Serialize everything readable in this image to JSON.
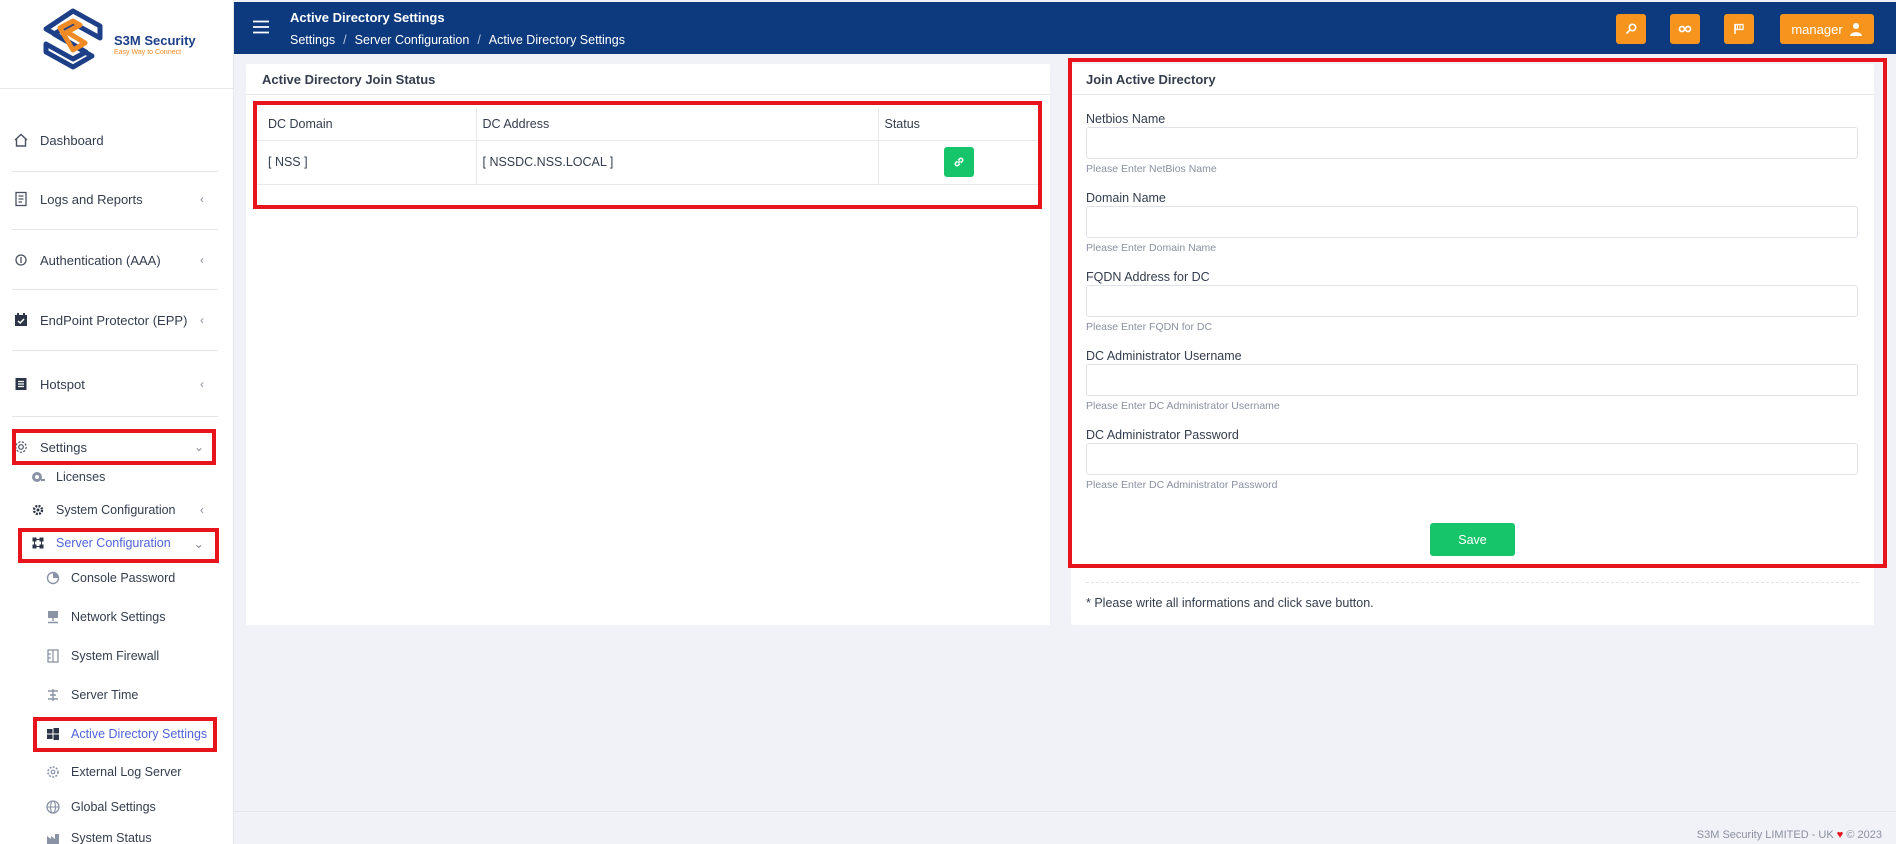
{
  "app": {
    "brand": "S3M Security",
    "tagline": "Easy Way to Connect"
  },
  "header": {
    "title": "Active Directory Settings",
    "breadcrumb": [
      "Settings",
      "Server Configuration",
      "Active Directory Settings"
    ],
    "user_label": "manager"
  },
  "sidebar": {
    "items": [
      {
        "label": "Dashboard",
        "icon": "home-icon"
      },
      {
        "label": "Logs and Reports",
        "icon": "report-icon"
      },
      {
        "label": "Authentication (AAA)",
        "icon": "auth-icon"
      },
      {
        "label": "EndPoint Protector (EPP)",
        "icon": "calendar-check-icon"
      },
      {
        "label": "Hotspot",
        "icon": "list-icon"
      },
      {
        "label": "Settings",
        "icon": "gear-icon"
      }
    ],
    "settings_sub": [
      {
        "label": "Licenses"
      },
      {
        "label": "System Configuration"
      },
      {
        "label": "Server Configuration"
      }
    ],
    "server_sub": [
      {
        "label": "Console Password"
      },
      {
        "label": "Network Settings"
      },
      {
        "label": "System Firewall"
      },
      {
        "label": "Server Time"
      },
      {
        "label": "Active Directory Settings"
      },
      {
        "label": "External Log Server"
      },
      {
        "label": "Global Settings"
      },
      {
        "label": "System Status"
      }
    ]
  },
  "join_status": {
    "title": "Active Directory Join Status",
    "columns": [
      "DC Domain",
      "DC Address",
      "Status"
    ],
    "rows": [
      {
        "domain": "[ NSS ]",
        "address": "[ NSSDC.NSS.LOCAL ]",
        "status_icon": "link-icon"
      }
    ]
  },
  "join_form": {
    "title": "Join Active Directory",
    "fields": [
      {
        "label": "Netbios Name",
        "value": "",
        "help": "Please Enter NetBios Name"
      },
      {
        "label": "Domain Name",
        "value": "",
        "help": "Please Enter Domain Name"
      },
      {
        "label": "FQDN Address for DC",
        "value": "",
        "help": "Please Enter FQDN for DC"
      },
      {
        "label": "DC Administrator Username",
        "value": "",
        "help": "Please Enter DC Administrator Username"
      },
      {
        "label": "DC Administrator Password",
        "value": "",
        "help": "Please Enter DC Administrator Password"
      }
    ],
    "save_label": "Save",
    "note": "* Please write all informations and click save button."
  },
  "footer": {
    "company": "S3M Security LIMITED - UK",
    "year": "© 2023"
  },
  "colors": {
    "header_bg": "#0d3a7e",
    "accent_orange": "#f7941d",
    "success_green": "#16c56a",
    "active_blue": "#4f63d8",
    "highlight_red": "#e8141b"
  }
}
